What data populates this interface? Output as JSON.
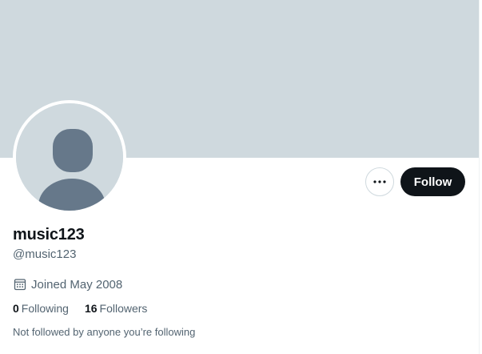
{
  "profile": {
    "display_name": "music123",
    "handle": "@music123",
    "joined": "Joined May 2008",
    "following_count": "0",
    "following_label": "Following",
    "followers_count": "16",
    "followers_label": "Followers",
    "mutual_note": "Not followed by anyone you’re following"
  },
  "actions": {
    "follow_label": "Follow",
    "more_icon": "more-dots-icon"
  },
  "icons": {
    "calendar": "calendar-icon",
    "avatar": "default-avatar-silhouette"
  },
  "colors": {
    "banner": "#cfd9de",
    "avatar_bg": "#cfd9de",
    "avatar_figure": "#66788a",
    "text_primary": "#0f1419",
    "text_secondary": "#536471",
    "follow_bg": "#0f1419",
    "follow_text": "#ffffff"
  }
}
